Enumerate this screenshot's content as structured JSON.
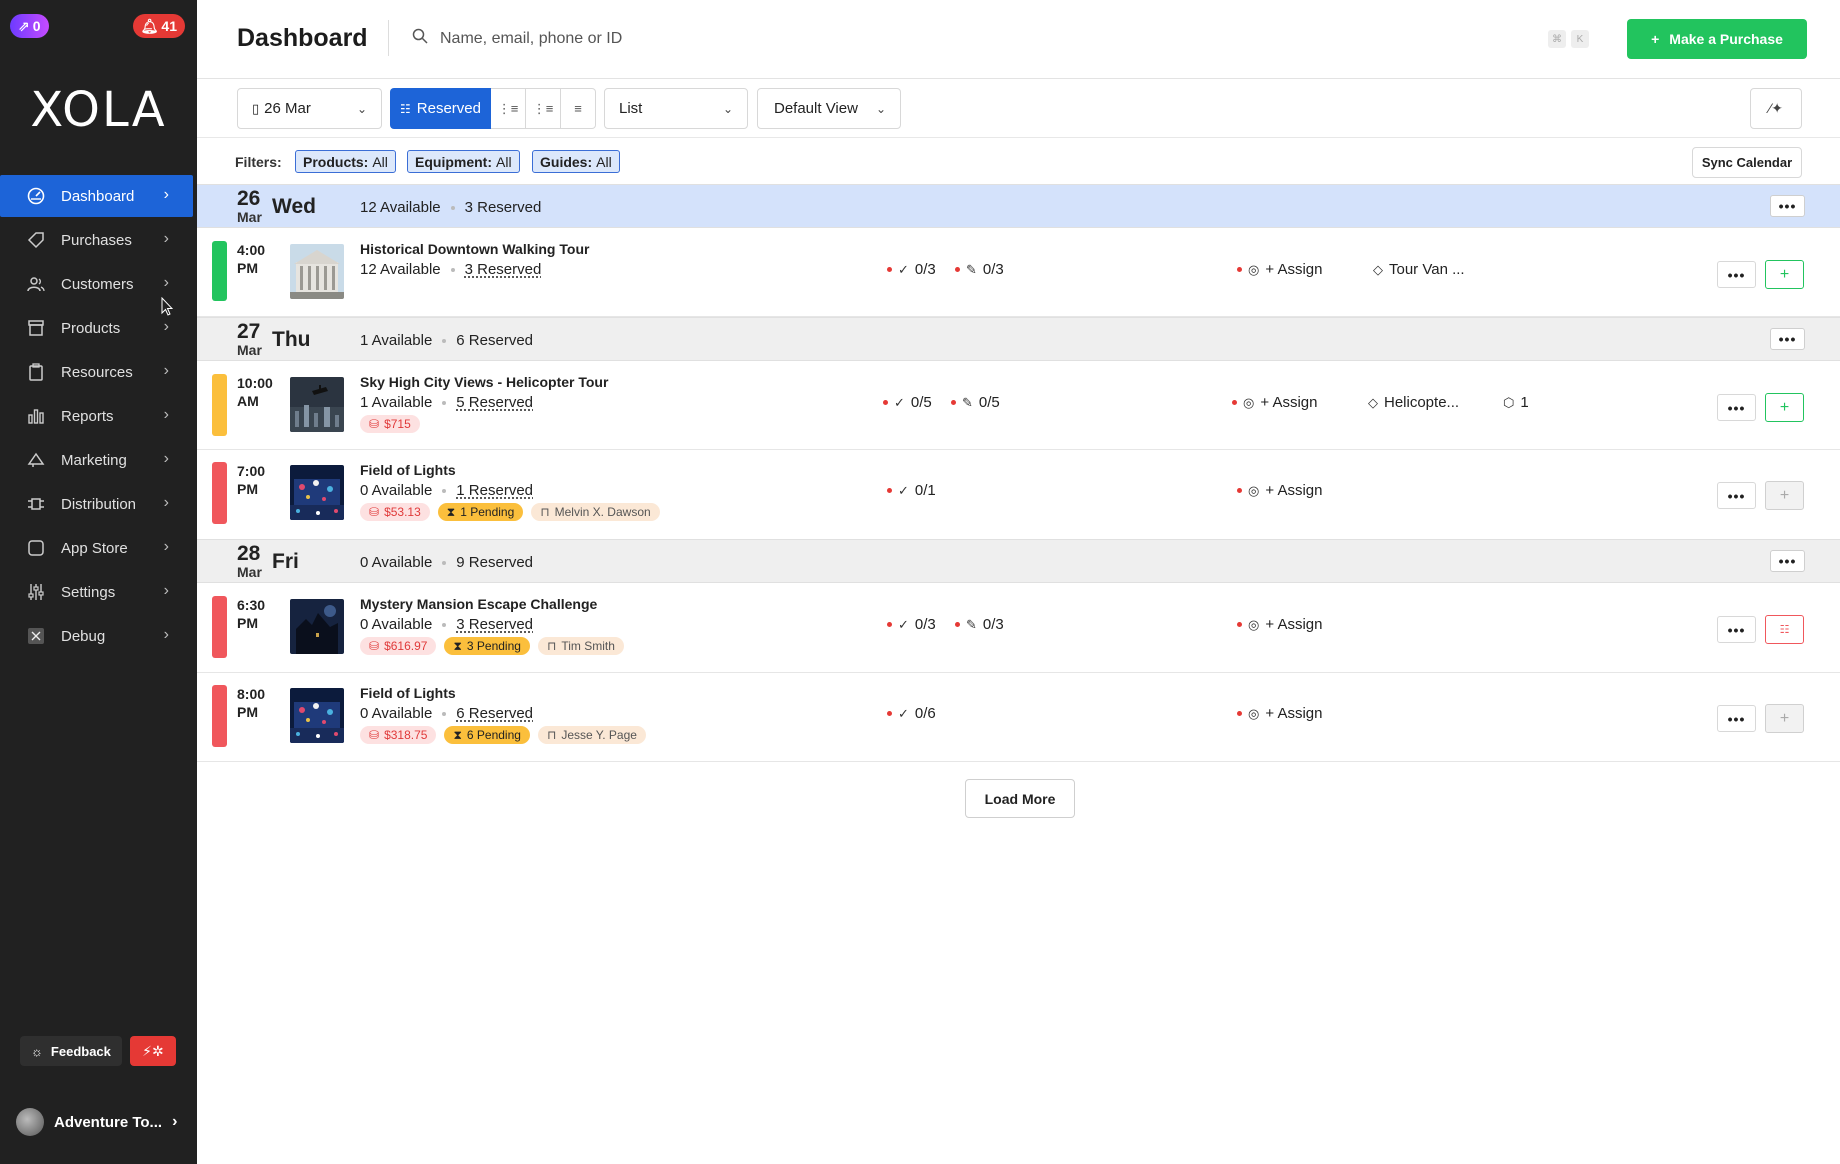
{
  "sidebar": {
    "notif_purple": "0",
    "notif_red": "41",
    "logo": "XOLA",
    "items": [
      {
        "label": "Dashboard",
        "icon": "dashboard-icon",
        "active": true
      },
      {
        "label": "Purchases",
        "icon": "tag-icon"
      },
      {
        "label": "Customers",
        "icon": "users-icon"
      },
      {
        "label": "Products",
        "icon": "box-icon"
      },
      {
        "label": "Resources",
        "icon": "clipboard-icon"
      },
      {
        "label": "Reports",
        "icon": "bar-chart-icon"
      },
      {
        "label": "Marketing",
        "icon": "megaphone-icon"
      },
      {
        "label": "Distribution",
        "icon": "distribution-icon"
      },
      {
        "label": "App Store",
        "icon": "app-store-icon"
      },
      {
        "label": "Settings",
        "icon": "sliders-icon"
      },
      {
        "label": "Debug",
        "icon": "debug-icon"
      }
    ],
    "feedback_label": "Feedback",
    "account_name": "Adventure To..."
  },
  "header": {
    "title": "Dashboard",
    "search_placeholder": "Name, email, phone or ID",
    "kbd_1": "⌘",
    "kbd_2": "K",
    "purchase_label": "Make a Purchase"
  },
  "toolbar": {
    "date": "26 Mar",
    "reserved_label": "Reserved",
    "list_label": "List",
    "view_label": "Default View"
  },
  "filters": {
    "label": "Filters:",
    "chips": [
      {
        "name": "Products:",
        "value": "All"
      },
      {
        "name": "Equipment:",
        "value": "All"
      },
      {
        "name": "Guides:",
        "value": "All"
      }
    ],
    "sync_label": "Sync Calendar"
  },
  "days": [
    {
      "num": "26",
      "mon": "Mar",
      "name": "Wed",
      "available": "12 Available",
      "reserved": "3 Reserved"
    },
    {
      "num": "27",
      "mon": "Mar",
      "name": "Thu",
      "available": "1 Available",
      "reserved": "6 Reserved"
    },
    {
      "num": "28",
      "mon": "Mar",
      "name": "Fri",
      "available": "0 Available",
      "reserved": "9 Reserved"
    }
  ],
  "events": [
    {
      "time1": "4:00",
      "time2": "PM",
      "title": "Historical Downtown Walking Tour",
      "available": "12 Available",
      "reserved": "3 Reserved",
      "checkin": "0/3",
      "waiver": "0/3",
      "assign": "+ Assign",
      "resource": "Tour Van ...",
      "status": "green"
    },
    {
      "time1": "10:00",
      "time2": "AM",
      "title": "Sky High City Views - Helicopter Tour",
      "available": "1 Available",
      "reserved": "5 Reserved",
      "price": "$715",
      "checkin": "0/5",
      "waiver": "0/5",
      "assign": "+ Assign",
      "resource": "Helicopte...",
      "equipment": "1",
      "status": "yellow"
    },
    {
      "time1": "7:00",
      "time2": "PM",
      "title": "Field of Lights",
      "available": "0 Available",
      "reserved": "1 Reserved",
      "price": "$53.13",
      "pending": "1 Pending",
      "guest": "Melvin X. Dawson",
      "checkin": "0/1",
      "assign": "+ Assign",
      "status": "red"
    },
    {
      "time1": "6:30",
      "time2": "PM",
      "title": "Mystery Mansion Escape Challenge",
      "available": "0 Available",
      "reserved": "3 Reserved",
      "price": "$616.97",
      "pending": "3 Pending",
      "guest": "Tim Smith",
      "checkin": "0/3",
      "waiver": "0/3",
      "assign": "+ Assign",
      "status": "red"
    },
    {
      "time1": "8:00",
      "time2": "PM",
      "title": "Field of Lights",
      "available": "0 Available",
      "reserved": "6 Reserved",
      "price": "$318.75",
      "pending": "6 Pending",
      "guest": "Jesse Y. Page",
      "checkin": "0/6",
      "assign": "+ Assign",
      "status": "red"
    }
  ],
  "load_more_label": "Load More",
  "colors": {
    "primary": "#1d64d8",
    "success": "#22c45e",
    "warning": "#fbbf3c",
    "danger": "#f0575c",
    "sidebar": "#212121"
  }
}
